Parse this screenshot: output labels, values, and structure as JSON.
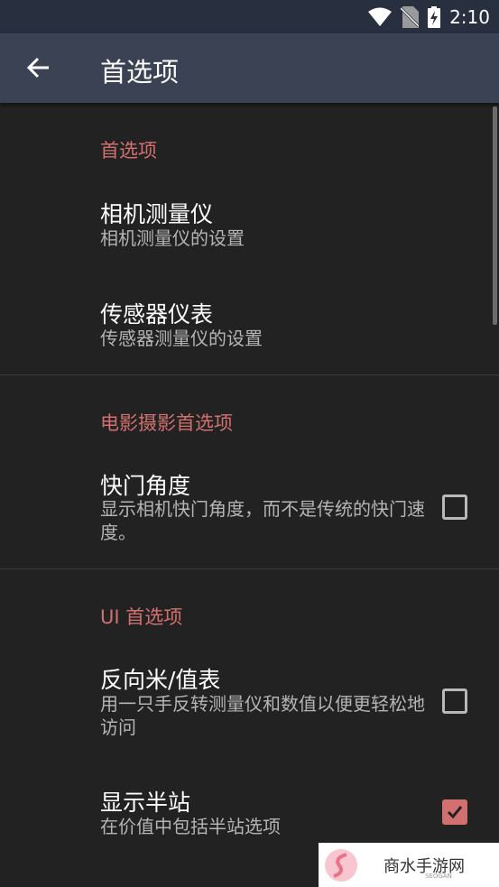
{
  "status_bar": {
    "time": "2:10"
  },
  "app_bar": {
    "title": "首选项"
  },
  "sections": {
    "general": {
      "header": "首选项",
      "camera_meter": {
        "title": "相机测量仪",
        "summary": "相机测量仪的设置"
      },
      "sensor_meter": {
        "title": "传感器仪表",
        "summary": "传感器测量仪的设置"
      }
    },
    "cinema": {
      "header": "电影摄影首选项",
      "shutter_angle": {
        "title": "快门角度",
        "summary": "显示相机快门角度，而不是传统的快门速度。",
        "checked": false
      }
    },
    "ui": {
      "header": "UI 首选项",
      "reverse_meter": {
        "title": "反向米/值表",
        "summary": "用一只手反转测量仪和数值以便更轻松地访问",
        "checked": false
      },
      "half_stops": {
        "title": "显示半站",
        "summary": "在价值中包括半站选项",
        "checked": true
      }
    }
  },
  "watermark": {
    "text": "商水手游网",
    "sub": "SEOGAN"
  },
  "colors": {
    "accent": "#d2706f",
    "app_bar": "#3a4254",
    "background": "#222222"
  }
}
